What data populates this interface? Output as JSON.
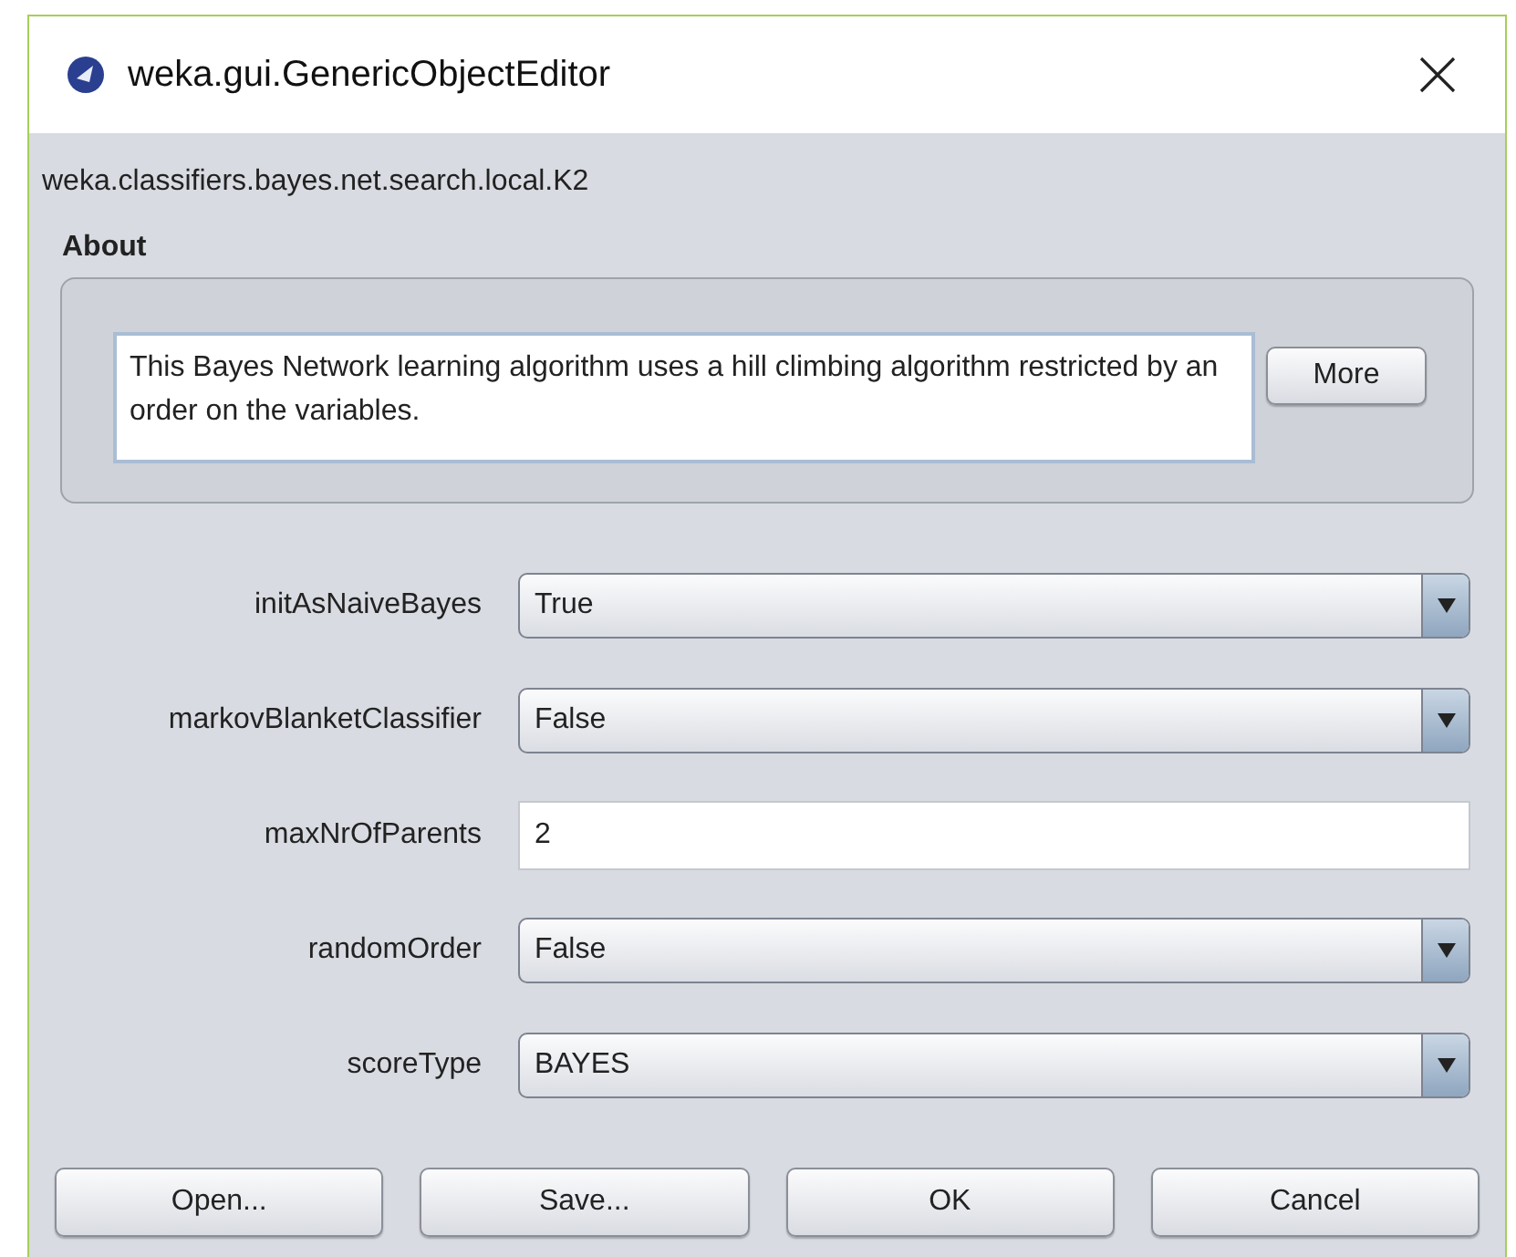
{
  "window": {
    "title": "weka.gui.GenericObjectEditor"
  },
  "class_name": "weka.classifiers.bayes.net.search.local.K2",
  "about": {
    "heading": "About",
    "text": "This Bayes Network learning algorithm uses a hill climbing algorithm restricted by an order on the variables.",
    "button": "More"
  },
  "properties": [
    {
      "label": "initAsNaiveBayes",
      "kind": "dropdown",
      "value": "True"
    },
    {
      "label": "markovBlanketClassifier",
      "kind": "dropdown",
      "value": "False"
    },
    {
      "label": "maxNrOfParents",
      "kind": "text",
      "value": "2"
    },
    {
      "label": "randomOrder",
      "kind": "dropdown",
      "value": "False"
    },
    {
      "label": "scoreType",
      "kind": "dropdown",
      "value": "BAYES"
    }
  ],
  "buttons": [
    "Open...",
    "Save...",
    "OK",
    "Cancel"
  ]
}
